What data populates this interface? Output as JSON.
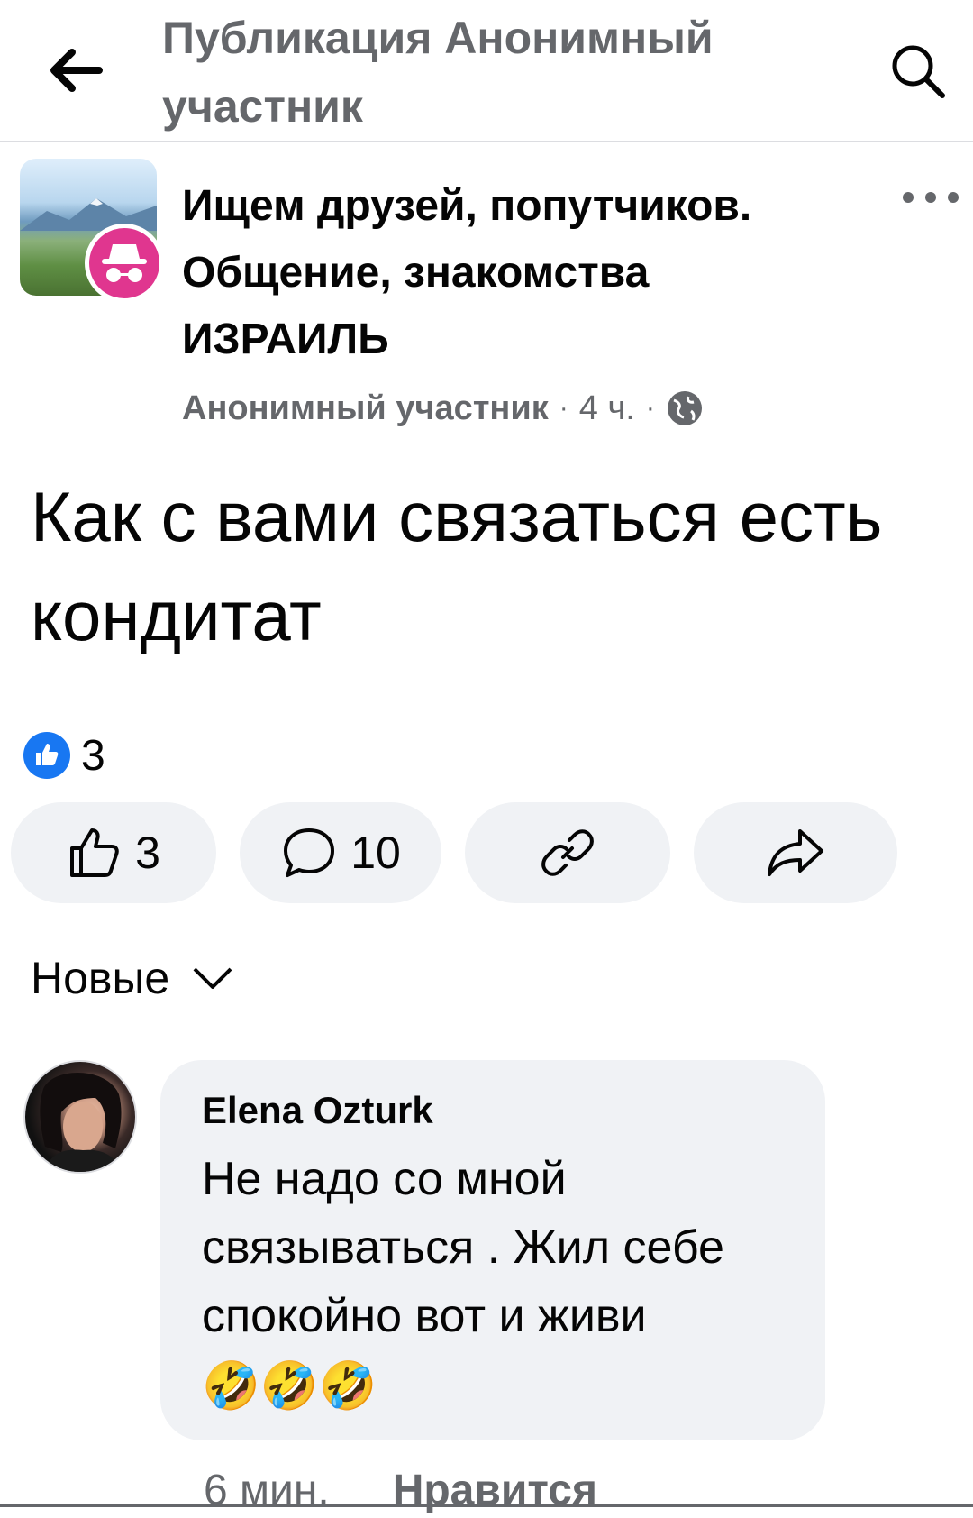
{
  "topbar": {
    "title": "Публикация Анонимный участник",
    "back_icon": "arrow-left-icon",
    "search_icon": "search-icon"
  },
  "post": {
    "group_name": "Ищем друзей, попутчиков. Общение, знакомства ИЗРАИЛЬ",
    "author": "Анонимный участник",
    "time": "4 ч.",
    "privacy_icon": "globe-icon",
    "separator": "·",
    "text": "Как с вами связаться есть кондитат",
    "reaction_count": "3",
    "actions": {
      "like_count": "3",
      "comment_count": "10"
    }
  },
  "sort": {
    "label": "Новые"
  },
  "comment": {
    "author": "Elena Ozturk",
    "text": "Не надо со мной связываться . Жил себе спокойно вот и живи",
    "emoji": "🤣🤣🤣",
    "time": "6 мин.",
    "like_label": "Нравится"
  },
  "colors": {
    "accent": "#1877f2",
    "badge": "#e0368f",
    "pill_bg": "#f0f2f5",
    "secondary_text": "#65676b"
  }
}
